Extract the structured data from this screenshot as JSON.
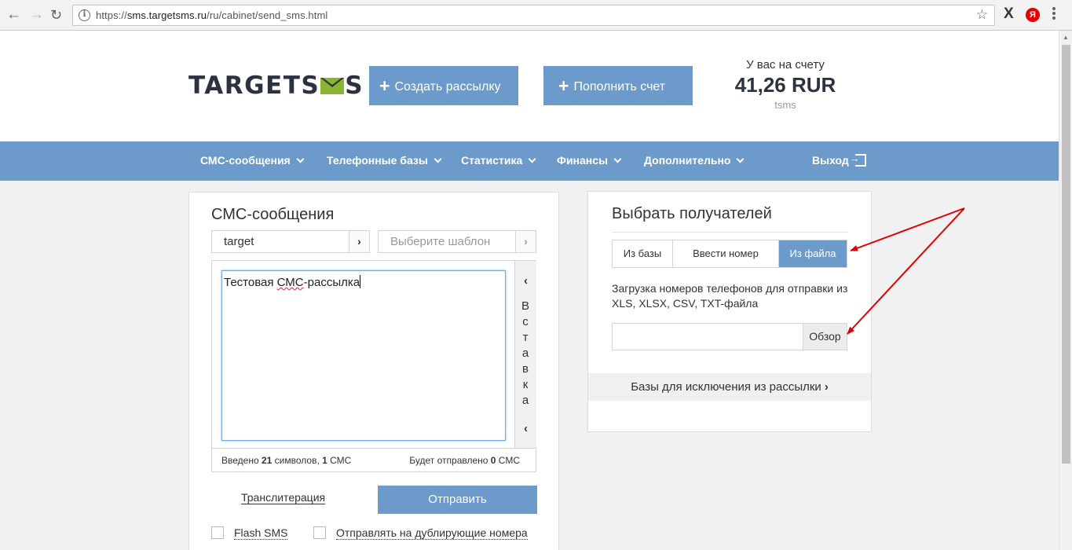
{
  "browser": {
    "url_scheme": "https://",
    "url_host": "sms.targetsms.ru",
    "url_path": "/ru/cabinet/send_sms.html",
    "back_icon": "←",
    "forward_icon": "→",
    "reload_icon": "↻",
    "info_icon": "i",
    "star_icon": "☆",
    "ext_x": "X",
    "ext_ya": "Я"
  },
  "header": {
    "logo_left": "TARGETS",
    "logo_right": "S",
    "create_button": "Создать рассылку",
    "fund_button": "Пополнить счет",
    "plus_symbol": "+",
    "balance_label": "У вас на счету",
    "balance_amount": "41,26 RUR",
    "username": "tsms"
  },
  "nav": {
    "items": [
      "СМС-сообщения",
      "Телефонные базы",
      "Статистика",
      "Финансы",
      "Дополнительно"
    ],
    "exit": "Выход"
  },
  "sms_panel": {
    "title": "СМС-сообщения",
    "sender": "target",
    "template_placeholder": "Выберите шаблон",
    "select_arrow": "›",
    "message_before": "Тестовая ",
    "message_misspelled": "СМС",
    "message_after": "-рассылка",
    "insert_label": "Вставка",
    "chevron_up": "‹",
    "chevron_down": "‹",
    "typed_prefix": "Введено ",
    "typed_chars": "21",
    "typed_mid": " символов, ",
    "typed_sms": "1",
    "typed_suffix": " СМС",
    "will_send_prefix": "Будет отправлено ",
    "will_send_count": "0",
    "will_send_suffix": " СМС",
    "translit": "Транслитерация",
    "send_button": "Отправить",
    "flash_sms": "Flash SMS",
    "duplicates": "Отправлять на дублирующие номера"
  },
  "recipients_panel": {
    "title": "Выбрать получателей",
    "tabs": [
      "Из базы",
      "Ввести номер",
      "Из файла"
    ],
    "active_tab": "Из файла",
    "description": "Загрузка номеров телефонов для отправки из XLS, XLSX, CSV, TXT-файла",
    "browse_button": "Обзор",
    "exclusions": "Базы для исключения из рассылки",
    "exclusions_arrow": "›"
  },
  "colors": {
    "accent": "#6b9acb",
    "logo_dark": "#2b3240",
    "logo_green": "#8ab431",
    "annotation": "#e00000"
  }
}
